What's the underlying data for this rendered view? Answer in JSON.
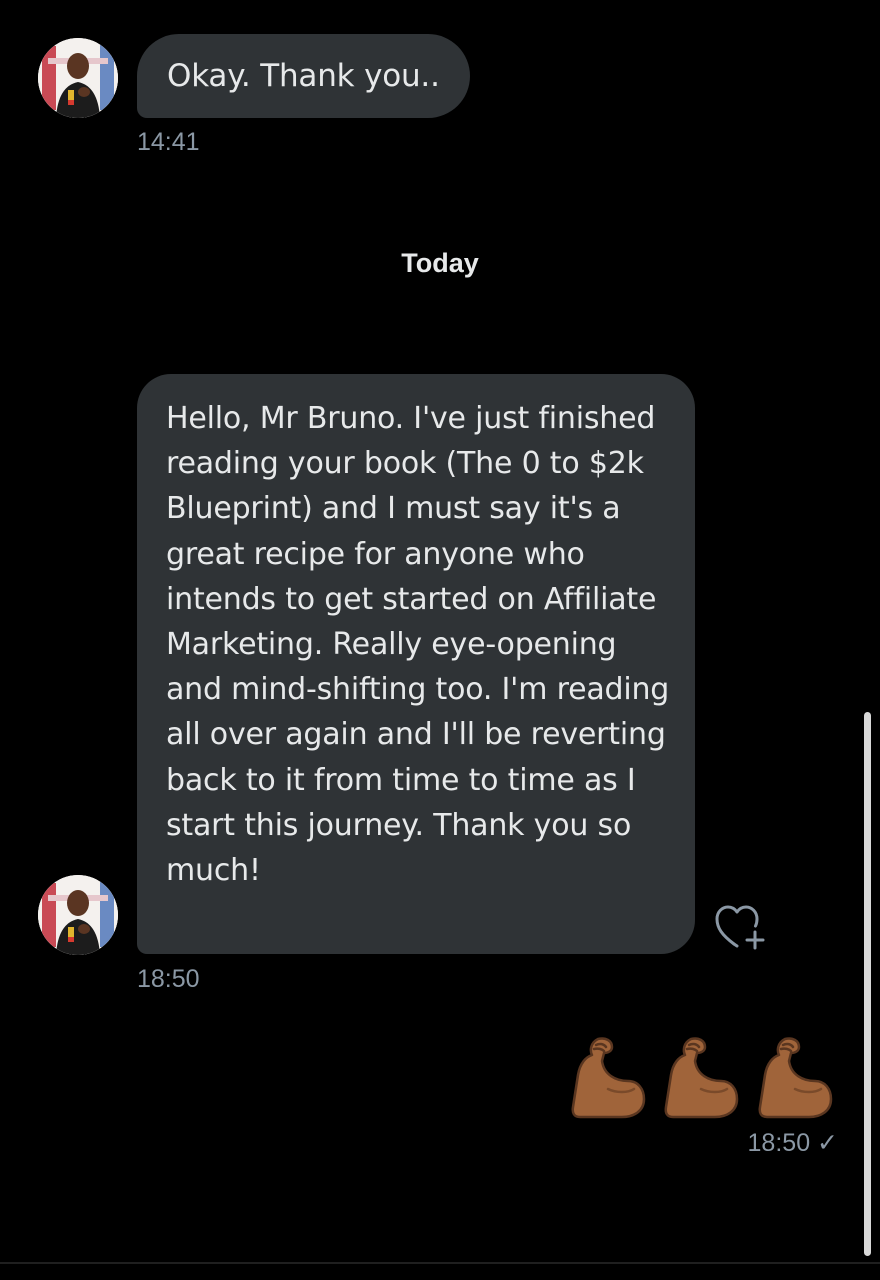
{
  "conversation": {
    "messages": [
      {
        "text": "Okay. Thank you..",
        "time": "14:41"
      },
      {
        "text": "Hello, Mr Bruno. I've just finished reading your book (The 0 to $2k Blueprint) and I must say it's a great recipe for anyone who intends to get started on Affiliate Marketing. Really eye-opening and mind-shifting too. I'm reading all over again and I'll be reverting back to it from time to time as I start this journey. Thank you so much!",
        "time": "18:50"
      }
    ],
    "day_separator": "Today",
    "sent": {
      "emojis": [
        "flexed-biceps-icon",
        "flexed-biceps-icon",
        "flexed-biceps-icon"
      ],
      "time": "18:50",
      "status_icon": "check-icon",
      "status_glyph": "✓"
    },
    "react_icon": "heart-plus-icon"
  },
  "colors": {
    "background": "#000000",
    "bubble": "#2f3336",
    "text": "#e7e9ea",
    "muted": "#8b98a5",
    "emoji_skin": "#a0643a"
  }
}
